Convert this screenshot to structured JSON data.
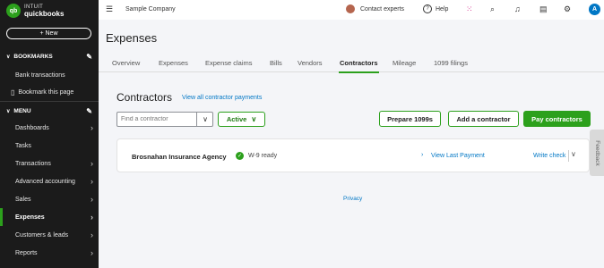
{
  "sidebar": {
    "logo_line1": "INTUIT",
    "logo_line2": "quickbooks",
    "logo_mark": "qb",
    "new_label": "+ New",
    "bookmarks_label": "BOOKMARKS",
    "bookmark_items": [
      "Bank transactions",
      "Bookmark this page"
    ],
    "menu_label": "MENU",
    "menu_items": [
      {
        "label": "Dashboards"
      },
      {
        "label": "Tasks"
      },
      {
        "label": "Transactions"
      },
      {
        "label": "Advanced accounting"
      },
      {
        "label": "Sales"
      },
      {
        "label": "Expenses"
      },
      {
        "label": "Customers & leads"
      },
      {
        "label": "Reports"
      }
    ],
    "active_item": "Expenses",
    "accent_color": "#2ca01c"
  },
  "topbar": {
    "company": "Sample Company",
    "contact_label": "Contact experts",
    "help_label": "Help",
    "user_initial": "A",
    "icons": [
      "menu-icon",
      "apps-grid-icon",
      "search-icon",
      "bell-icon",
      "clipboard-icon",
      "gear-icon"
    ]
  },
  "page": {
    "title": "Expenses",
    "tabs": [
      "Overview",
      "Expenses",
      "Expense claims",
      "Bills",
      "Vendors",
      "Contractors",
      "Mileage",
      "1099 filings"
    ],
    "active_tab": "Contractors"
  },
  "contractors": {
    "title": "Contractors",
    "view_all_link": "View all contractor payments",
    "search_placeholder": "Find a contractor",
    "filter_label": "Active",
    "prepare_button": "Prepare 1099s",
    "add_button": "Add a contractor",
    "pay_button": "Pay contractors",
    "rows": [
      {
        "name": "Brosnahan Insurance Agency",
        "status": "W-9 ready",
        "view_payment": "View Last Payment",
        "action": "Write check"
      }
    ]
  },
  "footer": {
    "privacy": "Privacy",
    "feedback": "Feedback"
  }
}
